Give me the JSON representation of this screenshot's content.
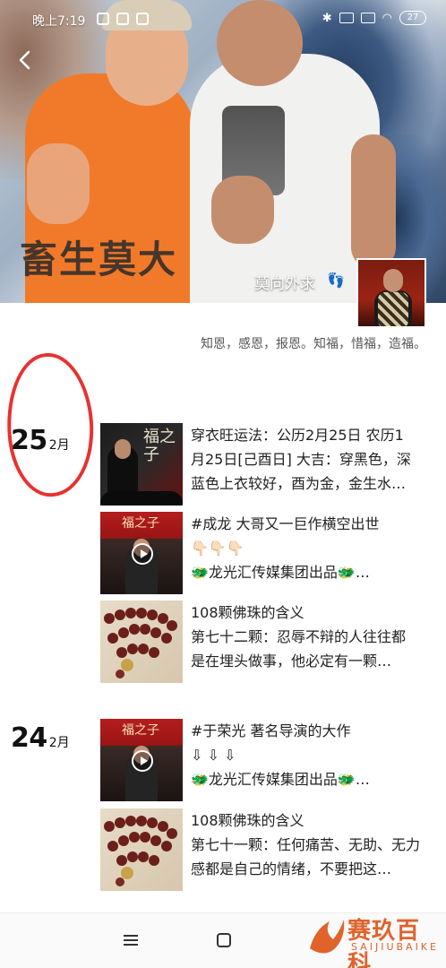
{
  "status_bar": {
    "time": "晚上7:19",
    "battery": "27"
  },
  "cover": {
    "calligraphy": "畜生莫大",
    "signature": "莫向外求",
    "foot_emoji": "👣"
  },
  "profile": {
    "bio": "知恩，感恩，报恩。知福，惜福，造福。"
  },
  "timeline": [
    {
      "day": "25",
      "month": "2月",
      "posts": [
        {
          "thumb": "poster",
          "thumb_calligraphy": "福之子",
          "lines": [
            "穿衣旺运法：公历2月25日 农历1",
            "月25日[己酉日] 大吉：穿黑色，深",
            "蓝色上衣较好，酉为金，金生水…"
          ]
        },
        {
          "thumb": "video",
          "thumb_calligraphy": "福之子",
          "lines": [
            "#成龙 大哥又一巨作横空出世",
            "👇🏻👇🏻👇🏻",
            "🐲龙光汇传媒集团出品🐲…"
          ]
        },
        {
          "thumb": "beads",
          "lines": [
            "108颗佛珠的含义",
            "第七十二颗：忍辱不辩的人往往都",
            "是在埋头做事，他必定有一颗…"
          ]
        }
      ]
    },
    {
      "day": "24",
      "month": "2月",
      "posts": [
        {
          "thumb": "video",
          "thumb_calligraphy": "福之子",
          "lines": [
            "#于荣光 著名导演的大作",
            "  ⇩  ⇩  ⇩",
            "🐲龙光汇传媒集团出品🐲…"
          ]
        },
        {
          "thumb": "beads",
          "lines": [
            "108颗佛珠的含义",
            "第七十一颗：任何痛苦、无助、无力",
            "感都是自己的情绪，不要把这…"
          ]
        }
      ]
    }
  ],
  "watermark": {
    "cn": "赛玖百科",
    "en": "SAIJIUBAIKE"
  },
  "colors": {
    "annotation_circle": "#e8322f",
    "watermark": "#e0632b"
  }
}
